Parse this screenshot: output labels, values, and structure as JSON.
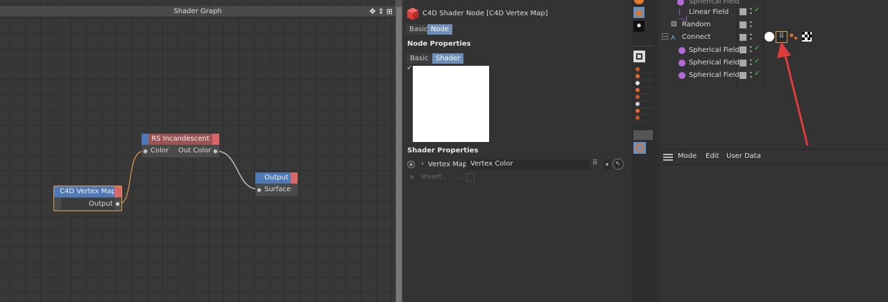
{
  "graph": {
    "title": "Shader Graph",
    "nodes": {
      "rs_incandescent": {
        "title": "RS Incandescent",
        "in_port": "Color",
        "out_port": "Out Color"
      },
      "output": {
        "title": "Output",
        "in_port": "Surface"
      },
      "vertex_map": {
        "title": "C4D Vertex Map",
        "out_port": "Output"
      }
    }
  },
  "attr": {
    "header_title": "C4D Shader Node [C4D Vertex Map]",
    "top_tabs": [
      "Basic",
      "Node"
    ],
    "node_properties_heading": "Node Properties",
    "node_tabs": [
      "Basic",
      "Shader"
    ],
    "shader_properties_heading": "Shader Properties",
    "vertex_map_label": "Vertex Map",
    "vertex_map_value": "Vertex Color",
    "invert_label": "Invert . . . . ."
  },
  "objects": {
    "rows": [
      "Spherical Field",
      "Linear Field",
      "Random",
      "Connect",
      "Spherical Field",
      "Spherical Field",
      "Spherical Field"
    ]
  },
  "attribute_manager": {
    "menu": [
      "Mode",
      "Edit",
      "User Data"
    ]
  },
  "colors": {
    "accent_blue": "#6d8fba",
    "node_red": "#d86868",
    "wire_orange": "#c8894a",
    "check_green": "#4fd24f",
    "arrow_red": "#e03c3c"
  }
}
